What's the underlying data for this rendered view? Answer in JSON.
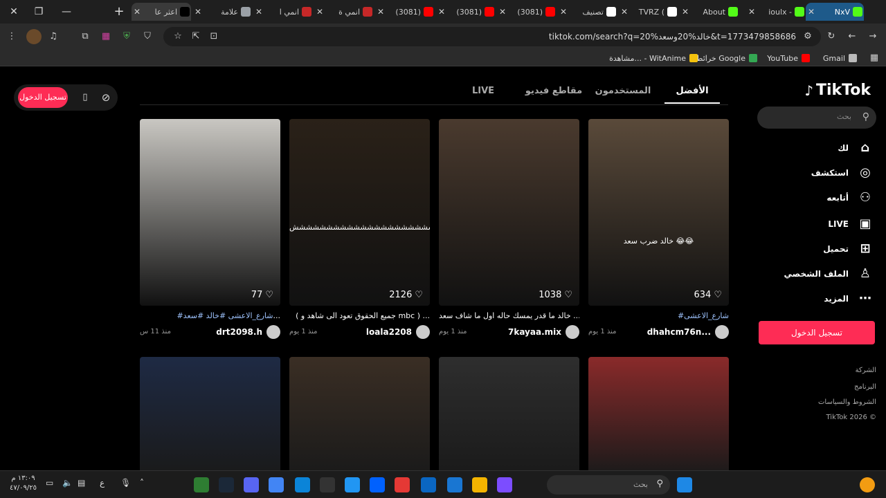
{
  "browser": {
    "window_controls": {
      "close": "✕",
      "restore": "❐",
      "minimize": "—",
      "new_tab": "+"
    },
    "tabs": [
      {
        "title": "اعثر عا",
        "icon": "tiktok-icon",
        "color": "#000000",
        "active": true
      },
      {
        "title": "علامة",
        "icon": "chrome-icon",
        "color": "#9aa0a6",
        "active": false
      },
      {
        "title": "انمي ا",
        "icon": "top-anime-icon",
        "color": "#c62828",
        "active": false
      },
      {
        "title": "انمي ة",
        "icon": "top-anime-icon",
        "color": "#c62828",
        "active": false
      },
      {
        "title": "(3081)",
        "icon": "youtube-icon",
        "color": "#ff0000",
        "active": false
      },
      {
        "title": "(3081)",
        "icon": "youtube-icon",
        "color": "#ff0000",
        "active": false
      },
      {
        "title": "(3081)",
        "icon": "youtube-icon",
        "color": "#ff0000",
        "active": false
      },
      {
        "title": "تصنيف",
        "icon": "diamond-icon",
        "color": "#ffffff",
        "active": false
      },
      {
        "title": "TVRZ (",
        "icon": "x-icon",
        "color": "#ffffff",
        "active": false
      },
      {
        "title": "About",
        "icon": "kick-icon",
        "color": "#53fc18",
        "active": false
      },
      {
        "title": "ioulx -",
        "icon": "kick-icon",
        "color": "#53fc18",
        "active": false
      },
      {
        "title": "NxV",
        "icon": "kick-icon",
        "color": "#53fc18",
        "active": false,
        "highlight": true
      }
    ],
    "url": "tiktok.com/search?q=خالد%20وسعد%20&t=1773479858686",
    "bookmarks": [
      {
        "label": "Gmail",
        "icon": "globe-icon",
        "color": "#bbbbbb"
      },
      {
        "label": "YouTube",
        "icon": "youtube-icon",
        "color": "#ff0000"
      },
      {
        "label": "خرائط Google",
        "icon": "maps-icon",
        "color": "#34a853"
      },
      {
        "label": "مشاهدة... - WitAnime",
        "icon": "witanime-icon",
        "color": "#f4c20d"
      }
    ]
  },
  "tiktok": {
    "logo_text": "TikTok",
    "sidebar_search_placeholder": "بحث",
    "nav": [
      {
        "label": "لك",
        "icon": "home-icon",
        "glyph": "⌂"
      },
      {
        "label": "استكشف",
        "icon": "compass-icon",
        "glyph": "◎"
      },
      {
        "label": "أتابعه",
        "icon": "following-icon",
        "glyph": "⚇"
      },
      {
        "label": "LIVE",
        "icon": "live-icon",
        "glyph": "▣"
      },
      {
        "label": "تحميل",
        "icon": "upload-icon",
        "glyph": "⊞"
      },
      {
        "label": "الملف الشخصي",
        "icon": "profile-icon",
        "glyph": "♙"
      },
      {
        "label": "المزيد",
        "icon": "more-icon",
        "glyph": "⋯"
      }
    ],
    "login_label": "تسجيل الدخول",
    "footer": [
      "الشركة",
      "البرنامج",
      "الشروط والسياسات",
      "TikTok 2026 ©"
    ],
    "search_tabs": [
      {
        "label": "الأفضل",
        "active": true
      },
      {
        "label": "المستخدمون",
        "active": false
      },
      {
        "label": "مقاطع فيديو",
        "active": false
      },
      {
        "label": "LIVE",
        "active": false
      }
    ],
    "videos_row1": [
      {
        "likes": "634",
        "caption_tag": "#شارع_الاعشى",
        "caption": "",
        "user": "dhahcm76n...",
        "time": "منذ 1 يوم",
        "overlay": "خالد ضرب سعد 😂😂",
        "bg": "#5a4a3a"
      },
      {
        "likes": "1038",
        "caption_tag": "",
        "caption": "خالد ما قدر يمسك حاله اول ما شاف سعد ...",
        "user": "7kayaa.mix",
        "time": "منذ 1 يوم",
        "overlay": "",
        "bg": "#4a3a2e"
      },
      {
        "likes": "2126",
        "caption_tag": "",
        "caption": "( جميع الحقوق تعود الى شاهد و mbc ) ...",
        "user": "loala2208",
        "time": "منذ 1 يوم",
        "overlay": "ششششششششششششششششششششش",
        "bg": "#2a2118"
      },
      {
        "likes": "77",
        "caption_tag": "#شارع_الاعشى #خالد #سعد",
        "caption": "...",
        "user": "drt2098.h",
        "time": "منذ 11 س",
        "overlay": "",
        "bg": "#c9c7c2"
      }
    ],
    "videos_row2": [
      {
        "bg": "#8a2a2a"
      },
      {
        "bg": "#2e2e2e"
      },
      {
        "bg": "#3a2e24"
      },
      {
        "bg": "#1e2a44"
      }
    ]
  },
  "taskbar": {
    "search_placeholder": "بحث",
    "time": "١٣:٠٩ م",
    "date": "٤٧/٠٩/٢٥",
    "lang": "ع",
    "apps": [
      "windows-icon",
      "gallery-icon",
      "file-explorer-icon",
      "store-icon",
      "outlook-icon",
      "copilot-icon",
      "todo-icon",
      "dropbox-icon",
      "terminal-icon",
      "epic-games-icon",
      "edge-icon",
      "chrome-icon",
      "discord-icon",
      "steam-icon",
      "xbox-icon"
    ]
  }
}
